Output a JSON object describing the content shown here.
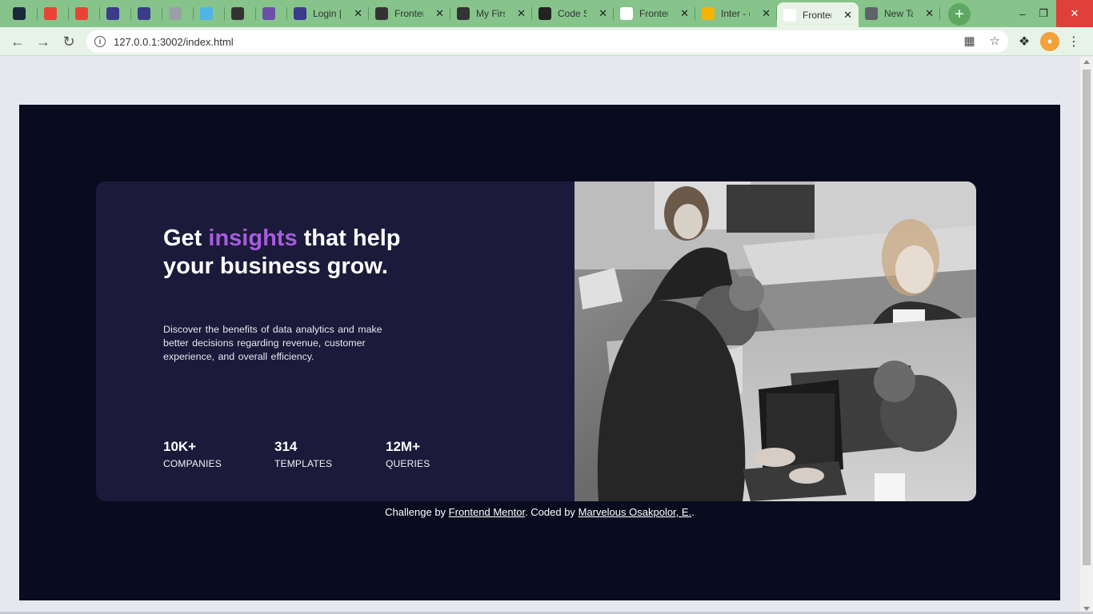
{
  "browser": {
    "tabs": [
      {
        "title": "",
        "icon": "site-icon-dark",
        "color": "#1a2a3a"
      },
      {
        "title": "",
        "icon": "gmail-icon",
        "color": "#ea4335"
      },
      {
        "title": "",
        "icon": "gmail-icon",
        "color": "#ea4335"
      },
      {
        "title": "",
        "icon": "app-icon",
        "color": "#3b3b8c"
      },
      {
        "title": "",
        "icon": "app-icon",
        "color": "#3b3b8c"
      },
      {
        "title": "",
        "icon": "doc-icon",
        "color": "#9aa0a6"
      },
      {
        "title": "",
        "icon": "file-icon",
        "color": "#4fb3e8"
      },
      {
        "title": "",
        "icon": "globe-icon",
        "color": "#333333"
      },
      {
        "title": "",
        "icon": "app-icon",
        "color": "#6b4fa8"
      },
      {
        "title": "Login |",
        "icon": "app-icon",
        "color": "#3b3b8c"
      },
      {
        "title": "Fronter",
        "icon": "globe-icon",
        "color": "#333333"
      },
      {
        "title": "My Firs",
        "icon": "globe-icon",
        "color": "#333333"
      },
      {
        "title": "Code S",
        "icon": "github-icon",
        "color": "#222222"
      },
      {
        "title": "Fronter",
        "icon": "frontend-mentor-icon",
        "color": "#ffffff"
      },
      {
        "title": "Inter - (",
        "icon": "fonts-icon",
        "color": "#f4b400"
      },
      {
        "title": "Fronter",
        "icon": "frontend-mentor-icon",
        "color": "#ffffff"
      },
      {
        "title": "New Ta",
        "icon": "chrome-icon",
        "color": "#5f6368"
      }
    ],
    "active_tab_index": 15,
    "url": "127.0.0.1:3002/index.html"
  },
  "card": {
    "headline_before": "Get ",
    "headline_accent": "insights",
    "headline_after": " that help your business grow.",
    "description": "Discover the benefits of data analytics and make better decisions regarding revenue, customer experience, and overall efficiency.",
    "stats": [
      {
        "value": "10K+",
        "label": "COMPANIES"
      },
      {
        "value": "314",
        "label": "TEMPLATES"
      },
      {
        "value": "12M+",
        "label": "QUERIES"
      }
    ]
  },
  "attribution": {
    "prefix": "Challenge by ",
    "link1": "Frontend Mentor",
    "middle": ". Coded by ",
    "link2": "Marvelous Osakpolor, E.",
    "suffix": "."
  },
  "colors": {
    "page_background": "#090b1e",
    "card_background": "#1c1a3a",
    "accent": "#a65ce0",
    "chrome_tabstrip": "#86c48b"
  }
}
